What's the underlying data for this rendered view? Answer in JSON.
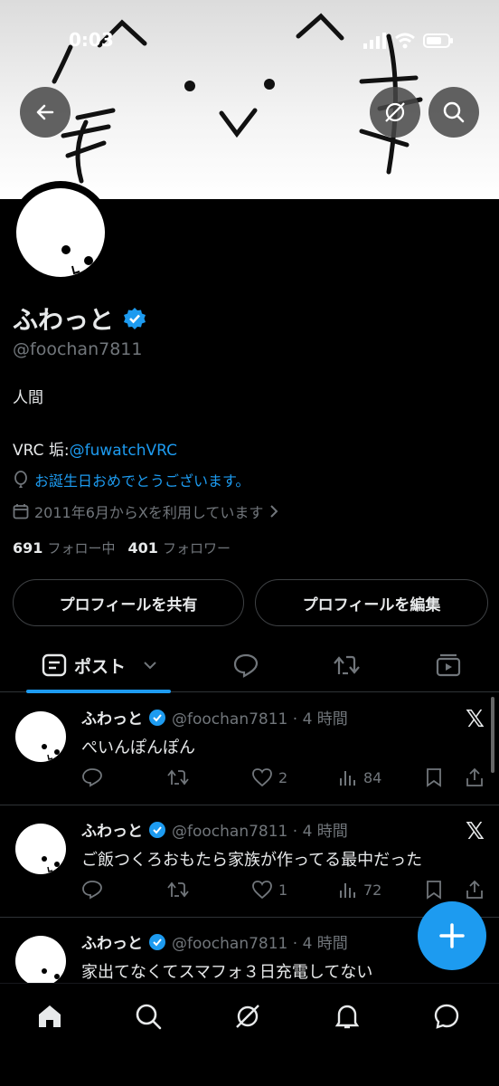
{
  "status_bar": {
    "time": "0:03"
  },
  "profile": {
    "name": "ふわっと",
    "handle": "@foochan7811",
    "bio_line1": "人間",
    "bio_prefix": "VRC 垢:",
    "bio_link": "@fuwatchVRC",
    "birthday": "お誕生日おめでとうございます。",
    "joined": "2011年6月からXを利用しています",
    "following_count": "691",
    "following_label": "フォロー中",
    "followers_count": "401",
    "followers_label": "フォロワー"
  },
  "buttons": {
    "share_profile": "プロフィールを共有",
    "edit_profile": "プロフィールを編集"
  },
  "tabs": {
    "posts_label": "ポスト"
  },
  "posts": [
    {
      "name": "ふわっと",
      "handle_time": "@foochan7811 · 4 時間",
      "text": "ぺいんぽんぽん",
      "likes": "2",
      "views": "84"
    },
    {
      "name": "ふわっと",
      "handle_time": "@foochan7811 · 4 時間",
      "text": "ご飯つくろおもたら家族が作ってる最中だった",
      "likes": "1",
      "views": "72"
    },
    {
      "name": "ふわっと",
      "handle_time": "@foochan7811 · 4 時間",
      "text": "家出てなくてスマフォ３日充電してない"
    }
  ],
  "colors": {
    "accent": "#1d9bf0",
    "background": "#000000",
    "muted": "#71767b"
  }
}
